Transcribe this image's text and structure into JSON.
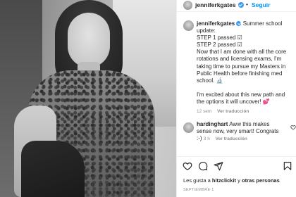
{
  "post": {
    "username": "jenniferkgates",
    "follow_label": "Seguir",
    "header_dot": "•"
  },
  "caption": {
    "username": "jenniferkgates",
    "intro": "Summer school update:",
    "line1": "STEP 1 passed ☑",
    "line2": "STEP 2 passed ☑",
    "body": "Now that I am done with all the core rotations and licensing exams, I'm taking time to pursue my Masters in Public Health before finishing med school. 🔬",
    "body2": "I'm excited about this new path and the options it will uncover! 💕",
    "time": "12 sem",
    "translate": "Ver traducción"
  },
  "comment": {
    "username": "hardinghart",
    "text": "Aww this makes sense now, very smart! Congrats :-)",
    "time": "3 h",
    "translate": "Ver traducción"
  },
  "likes": {
    "prefix": "Les gusta a ",
    "user": "hitzclickit",
    "middle": " y ",
    "others": "otras personas"
  },
  "date_label": "SEPTIEMBRE 1",
  "colors": {
    "accent": "#0095f6",
    "verified": "#3897f0",
    "muted": "#8e8e8e",
    "text": "#262626"
  },
  "icons": [
    "heart-icon",
    "comment-icon",
    "share-icon",
    "bookmark-icon",
    "verified-badge-icon",
    "small-heart-icon"
  ]
}
